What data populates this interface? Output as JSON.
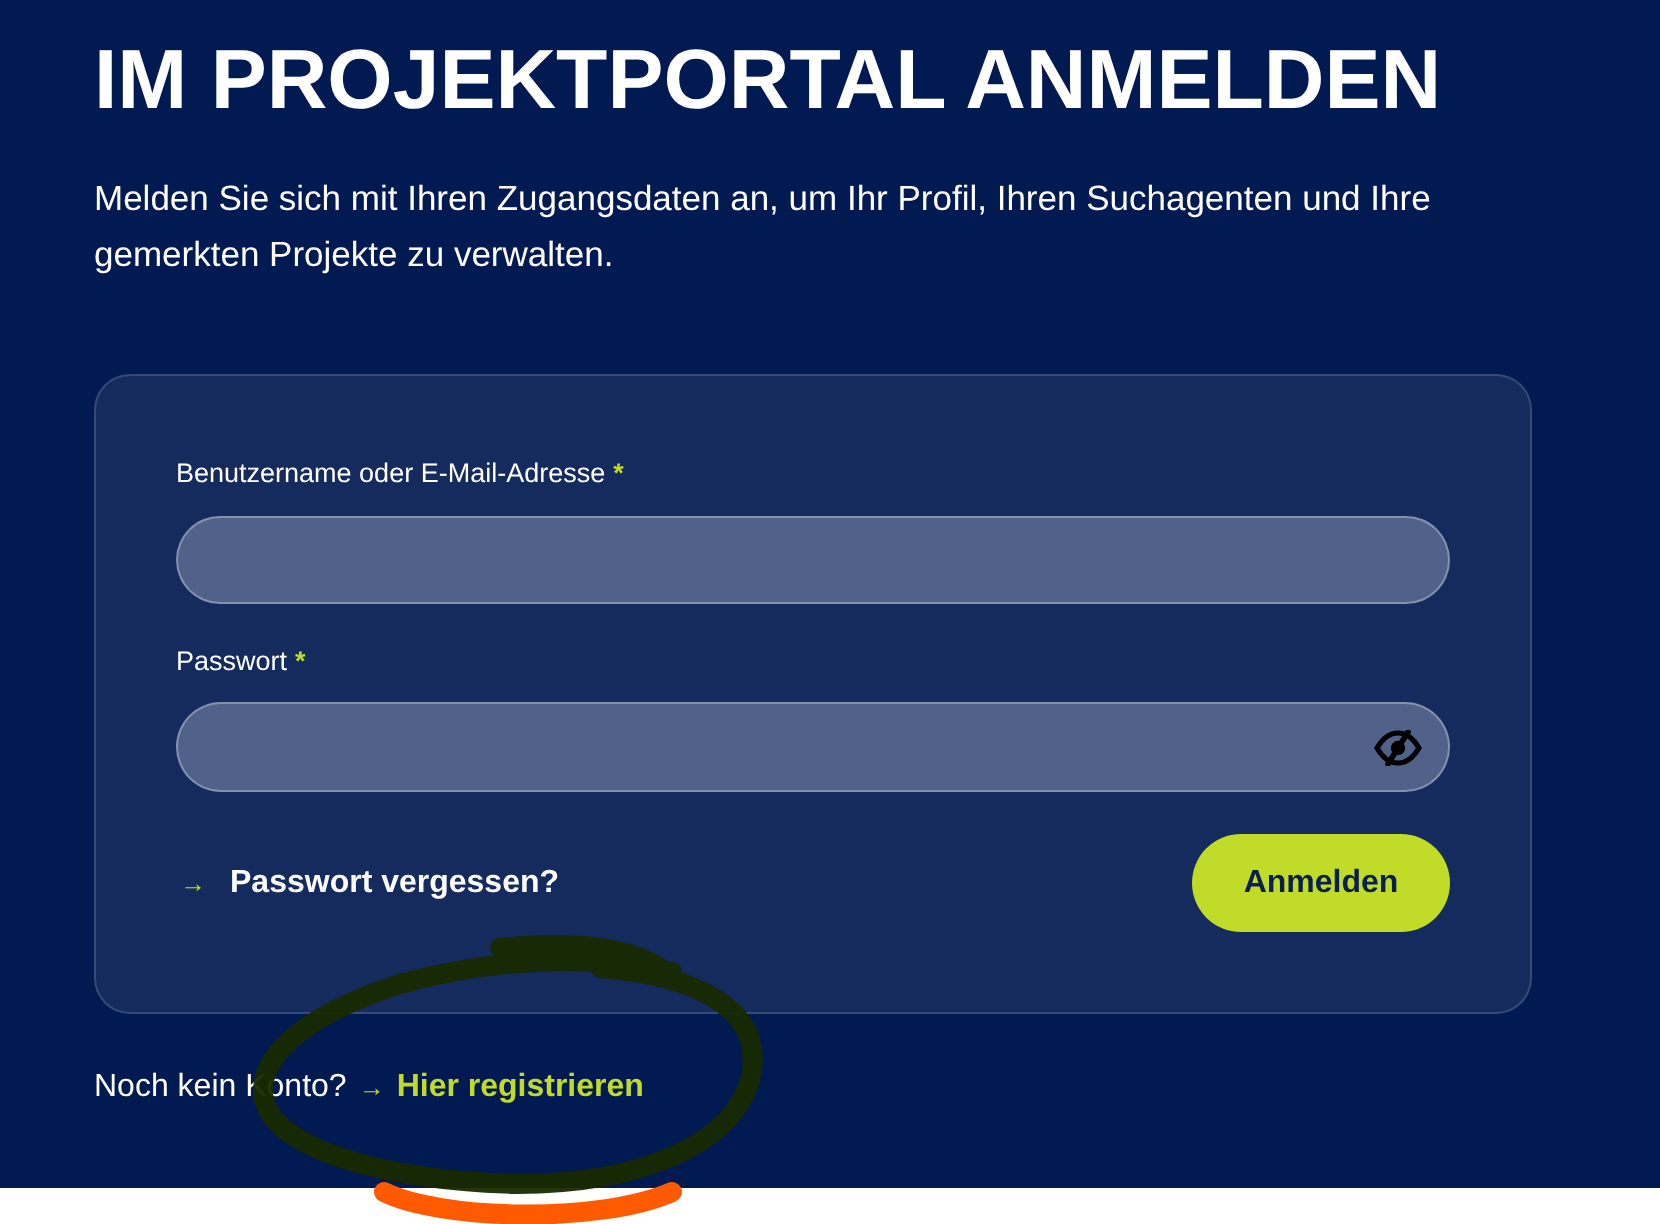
{
  "heading": "IM PROJEKTPORTAL ANMELDEN",
  "intro": "Melden Sie sich mit Ihren Zugangsdaten an, um Ihr Profil, Ihren Suchagenten und Ihre gemerkten Projekte zu verwalten.",
  "form": {
    "fields": [
      {
        "kind": "text",
        "label": "Benutzername oder E-Mail-Adresse",
        "required_mark": "*"
      },
      {
        "kind": "password",
        "label": "Passwort",
        "required_mark": "*"
      }
    ],
    "forgot_link": {
      "arrow": "→",
      "label": "Passwort vergessen?"
    },
    "submit_button": "Anmelden"
  },
  "register": {
    "prompt": "Noch kein Konto?",
    "arrow": "→",
    "link": "Hier registrieren"
  }
}
